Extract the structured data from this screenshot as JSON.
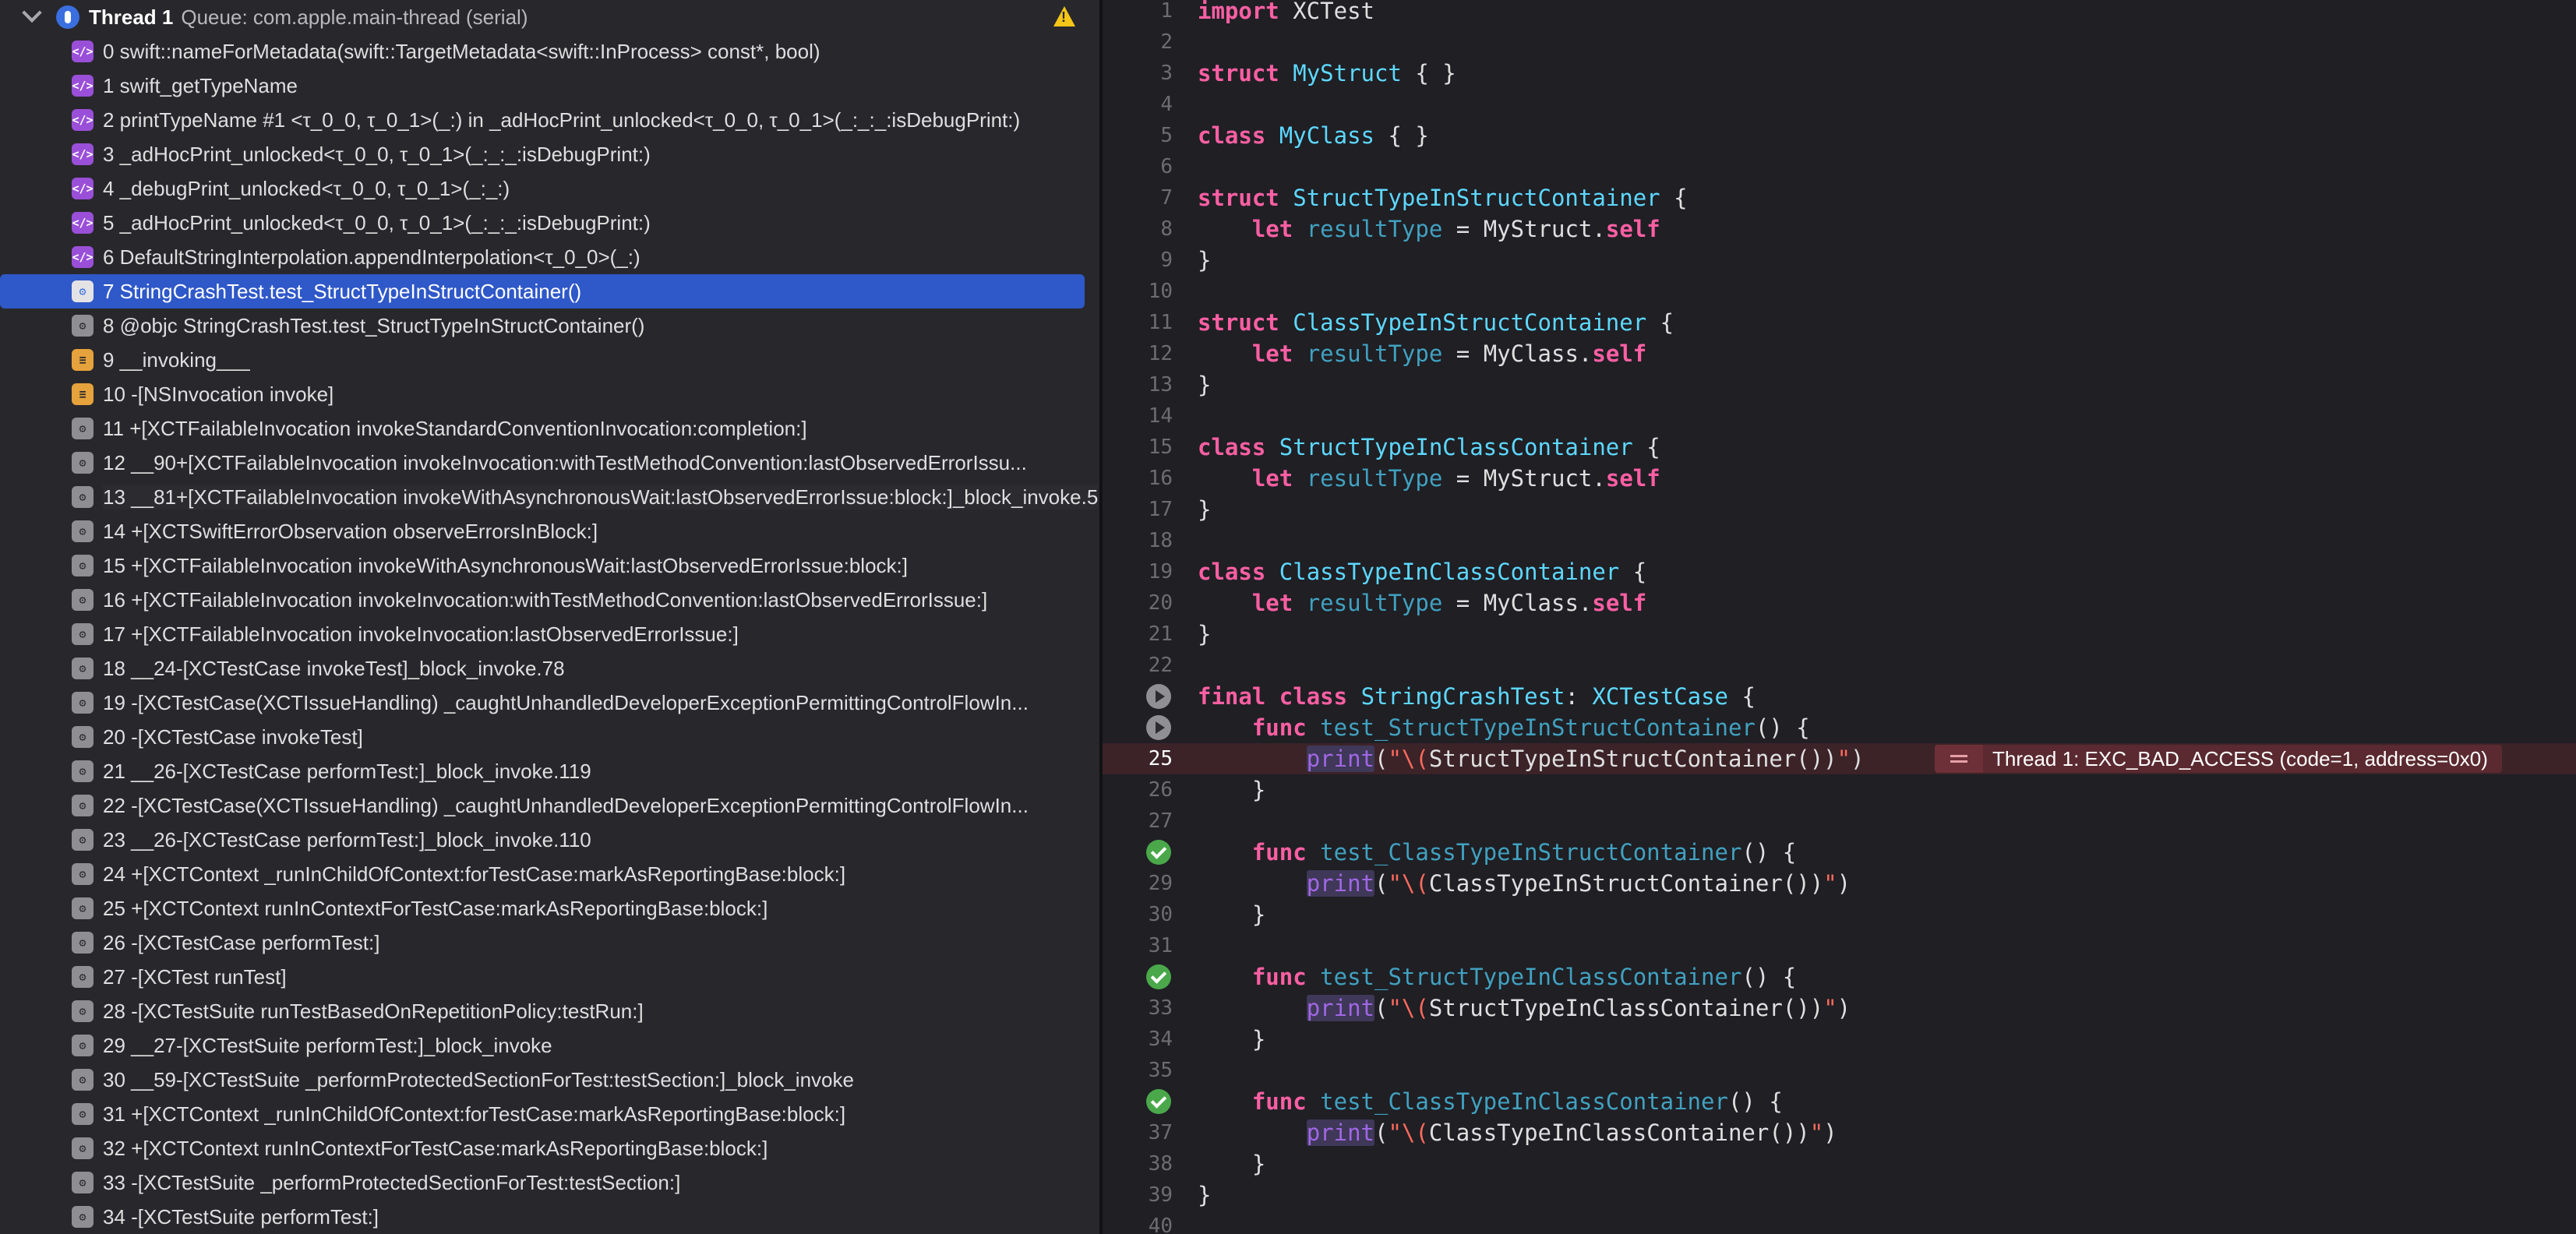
{
  "thread": {
    "title": "Thread 1",
    "queue": "Queue: com.apple.main-thread (serial)"
  },
  "frames": [
    {
      "label": "0 swift::nameForMetadata(swift::TargetMetadata<swift::InProcess> const*, bool)",
      "icon": "swift-icon"
    },
    {
      "label": "1 swift_getTypeName",
      "icon": "swift-icon"
    },
    {
      "label": "2 printTypeName #1 <τ_0_0, τ_0_1>(_:) in _adHocPrint_unlocked<τ_0_0, τ_0_1>(_:_:_:isDebugPrint:)",
      "icon": "swift-icon"
    },
    {
      "label": "3 _adHocPrint_unlocked<τ_0_0, τ_0_1>(_:_:_:isDebugPrint:)",
      "icon": "swift-icon"
    },
    {
      "label": "4 _debugPrint_unlocked<τ_0_0, τ_0_1>(_:_:)",
      "icon": "swift-icon"
    },
    {
      "label": "5 _adHocPrint_unlocked<τ_0_0, τ_0_1>(_:_:_:isDebugPrint:)",
      "icon": "swift-icon"
    },
    {
      "label": "6 DefaultStringInterpolation.appendInterpolation<τ_0_0>(_:)",
      "icon": "swift-icon"
    },
    {
      "label": "7 StringCrashTest.test_StructTypeInStructContainer()",
      "icon": "user-code-icon"
    },
    {
      "label": "8 @objc StringCrashTest.test_StructTypeInStructContainer()",
      "icon": "gear-icon"
    },
    {
      "label": "9 __invoking___",
      "icon": "objc-icon"
    },
    {
      "label": "10 -[NSInvocation invoke]",
      "icon": "objc-icon"
    },
    {
      "label": "11 +[XCTFailableInvocation invokeStandardConventionInvocation:completion:]",
      "icon": "gear-icon"
    },
    {
      "label": "12 __90+[XCTFailableInvocation invokeInvocation:withTestMethodConvention:lastObservedErrorIssu...",
      "icon": "gear-icon"
    },
    {
      "label": "13 __81+[XCTFailableInvocation invokeWithAsynchronousWait:lastObservedErrorIssue:block:]_block_invoke.5",
      "icon": "gear-icon"
    },
    {
      "label": "14 +[XCTSwiftErrorObservation observeErrorsInBlock:]",
      "icon": "gear-icon"
    },
    {
      "label": "15 +[XCTFailableInvocation invokeWithAsynchronousWait:lastObservedErrorIssue:block:]",
      "icon": "gear-icon"
    },
    {
      "label": "16 +[XCTFailableInvocation invokeInvocation:withTestMethodConvention:lastObservedErrorIssue:]",
      "icon": "gear-icon"
    },
    {
      "label": "17 +[XCTFailableInvocation invokeInvocation:lastObservedErrorIssue:]",
      "icon": "gear-icon"
    },
    {
      "label": "18 __24-[XCTestCase invokeTest]_block_invoke.78",
      "icon": "gear-icon"
    },
    {
      "label": "19 -[XCTestCase(XCTIssueHandling) _caughtUnhandledDeveloperExceptionPermittingControlFlowIn...",
      "icon": "gear-icon"
    },
    {
      "label": "20 -[XCTestCase invokeTest]",
      "icon": "gear-icon"
    },
    {
      "label": "21 __26-[XCTestCase performTest:]_block_invoke.119",
      "icon": "gear-icon"
    },
    {
      "label": "22 -[XCTestCase(XCTIssueHandling) _caughtUnhandledDeveloperExceptionPermittingControlFlowIn...",
      "icon": "gear-icon"
    },
    {
      "label": "23 __26-[XCTestCase performTest:]_block_invoke.110",
      "icon": "gear-icon"
    },
    {
      "label": "24 +[XCTContext _runInChildOfContext:forTestCase:markAsReportingBase:block:]",
      "icon": "gear-icon"
    },
    {
      "label": "25 +[XCTContext runInContextForTestCase:markAsReportingBase:block:]",
      "icon": "gear-icon"
    },
    {
      "label": "26 -[XCTestCase performTest:]",
      "icon": "gear-icon"
    },
    {
      "label": "27 -[XCTest runTest]",
      "icon": "gear-icon"
    },
    {
      "label": "28 -[XCTestSuite runTestBasedOnRepetitionPolicy:testRun:]",
      "icon": "gear-icon"
    },
    {
      "label": "29 __27-[XCTestSuite performTest:]_block_invoke",
      "icon": "gear-icon"
    },
    {
      "label": "30 __59-[XCTestSuite _performProtectedSectionForTest:testSection:]_block_invoke",
      "icon": "gear-icon"
    },
    {
      "label": "31 +[XCTContext _runInChildOfContext:forTestCase:markAsReportingBase:block:]",
      "icon": "gear-icon"
    },
    {
      "label": "32 +[XCTContext runInContextForTestCase:markAsReportingBase:block:]",
      "icon": "gear-icon"
    },
    {
      "label": "33 -[XCTestSuite _performProtectedSectionForTest:testSection:]",
      "icon": "gear-icon"
    },
    {
      "label": "34 -[XCTestSuite performTest:]",
      "icon": "gear-icon"
    }
  ],
  "selected_frame": 7,
  "editor": {
    "lines": [
      {
        "n": "1",
        "tokens": [
          [
            "kw",
            "import"
          ],
          [
            "plain",
            " XCTest"
          ]
        ]
      },
      {
        "n": "2",
        "tokens": []
      },
      {
        "n": "3",
        "tokens": [
          [
            "kw",
            "struct"
          ],
          [
            "plain",
            " "
          ],
          [
            "typ",
            "MyStruct"
          ],
          [
            "plain",
            " { }"
          ]
        ]
      },
      {
        "n": "4",
        "tokens": []
      },
      {
        "n": "5",
        "tokens": [
          [
            "kw",
            "class"
          ],
          [
            "plain",
            " "
          ],
          [
            "typ",
            "MyClass"
          ],
          [
            "plain",
            " { }"
          ]
        ]
      },
      {
        "n": "6",
        "tokens": []
      },
      {
        "n": "7",
        "tokens": [
          [
            "kw",
            "struct"
          ],
          [
            "plain",
            " "
          ],
          [
            "typ",
            "StructTypeInStructContainer"
          ],
          [
            "plain",
            " {"
          ]
        ]
      },
      {
        "n": "8",
        "tokens": [
          [
            "plain",
            "    "
          ],
          [
            "kw",
            "let"
          ],
          [
            "plain",
            " "
          ],
          [
            "decl",
            "resultType"
          ],
          [
            "plain",
            " = "
          ],
          [
            "plain",
            "MyStruct"
          ],
          [
            "plain",
            "."
          ],
          [
            "kw",
            "self"
          ]
        ]
      },
      {
        "n": "9",
        "tokens": [
          [
            "plain",
            "}"
          ]
        ]
      },
      {
        "n": "10",
        "tokens": []
      },
      {
        "n": "11",
        "tokens": [
          [
            "kw",
            "struct"
          ],
          [
            "plain",
            " "
          ],
          [
            "typ",
            "ClassTypeInStructContainer"
          ],
          [
            "plain",
            " {"
          ]
        ]
      },
      {
        "n": "12",
        "tokens": [
          [
            "plain",
            "    "
          ],
          [
            "kw",
            "let"
          ],
          [
            "plain",
            " "
          ],
          [
            "decl",
            "resultType"
          ],
          [
            "plain",
            " = "
          ],
          [
            "plain",
            "MyClass"
          ],
          [
            "plain",
            "."
          ],
          [
            "kw",
            "self"
          ]
        ]
      },
      {
        "n": "13",
        "tokens": [
          [
            "plain",
            "}"
          ]
        ]
      },
      {
        "n": "14",
        "tokens": []
      },
      {
        "n": "15",
        "tokens": [
          [
            "kw",
            "class"
          ],
          [
            "plain",
            " "
          ],
          [
            "typ",
            "StructTypeInClassContainer"
          ],
          [
            "plain",
            " {"
          ]
        ]
      },
      {
        "n": "16",
        "tokens": [
          [
            "plain",
            "    "
          ],
          [
            "kw",
            "let"
          ],
          [
            "plain",
            " "
          ],
          [
            "decl",
            "resultType"
          ],
          [
            "plain",
            " = "
          ],
          [
            "plain",
            "MyStruct"
          ],
          [
            "plain",
            "."
          ],
          [
            "kw",
            "self"
          ]
        ]
      },
      {
        "n": "17",
        "tokens": [
          [
            "plain",
            "}"
          ]
        ]
      },
      {
        "n": "18",
        "tokens": []
      },
      {
        "n": "19",
        "tokens": [
          [
            "kw",
            "class"
          ],
          [
            "plain",
            " "
          ],
          [
            "typ",
            "ClassTypeInClassContainer"
          ],
          [
            "plain",
            " {"
          ]
        ]
      },
      {
        "n": "20",
        "tokens": [
          [
            "plain",
            "    "
          ],
          [
            "kw",
            "let"
          ],
          [
            "plain",
            " "
          ],
          [
            "decl",
            "resultType"
          ],
          [
            "plain",
            " = "
          ],
          [
            "plain",
            "MyClass"
          ],
          [
            "plain",
            "."
          ],
          [
            "kw",
            "self"
          ]
        ]
      },
      {
        "n": "21",
        "tokens": [
          [
            "plain",
            "}"
          ]
        ]
      },
      {
        "n": "22",
        "tokens": []
      },
      {
        "n": "23",
        "marker": "run",
        "tokens": [
          [
            "kw",
            "final"
          ],
          [
            "plain",
            " "
          ],
          [
            "kw",
            "class"
          ],
          [
            "plain",
            " "
          ],
          [
            "typ",
            "StringCrashTest"
          ],
          [
            "plain",
            ": "
          ],
          [
            "typ",
            "XCTestCase"
          ],
          [
            "plain",
            " {"
          ]
        ]
      },
      {
        "n": "24",
        "marker": "run",
        "tokens": [
          [
            "plain",
            "    "
          ],
          [
            "kw",
            "func"
          ],
          [
            "plain",
            " "
          ],
          [
            "decl",
            "test_StructTypeInStructContainer"
          ],
          [
            "plain",
            "() {"
          ]
        ]
      },
      {
        "n": "25",
        "error": true,
        "tokens": [
          [
            "plain",
            "        "
          ],
          [
            "fn",
            "print"
          ],
          [
            "plain",
            "("
          ],
          [
            "str",
            "\"\\("
          ],
          [
            "plain",
            "StructTypeInStructContainer"
          ],
          [
            "plain",
            "())"
          ],
          [
            "str",
            "\""
          ],
          [
            "plain",
            ")"
          ]
        ]
      },
      {
        "n": "26",
        "tokens": [
          [
            "plain",
            "    }"
          ]
        ]
      },
      {
        "n": "27",
        "tokens": []
      },
      {
        "n": "28",
        "marker": "pass",
        "tokens": [
          [
            "plain",
            "    "
          ],
          [
            "kw",
            "func"
          ],
          [
            "plain",
            " "
          ],
          [
            "decl",
            "test_ClassTypeInStructContainer"
          ],
          [
            "plain",
            "() {"
          ]
        ]
      },
      {
        "n": "29",
        "tokens": [
          [
            "plain",
            "        "
          ],
          [
            "fn",
            "print"
          ],
          [
            "plain",
            "("
          ],
          [
            "str",
            "\"\\("
          ],
          [
            "plain",
            "ClassTypeInStructContainer"
          ],
          [
            "plain",
            "())"
          ],
          [
            "str",
            "\""
          ],
          [
            "plain",
            ")"
          ]
        ]
      },
      {
        "n": "30",
        "tokens": [
          [
            "plain",
            "    }"
          ]
        ]
      },
      {
        "n": "31",
        "tokens": []
      },
      {
        "n": "32",
        "marker": "pass",
        "tokens": [
          [
            "plain",
            "    "
          ],
          [
            "kw",
            "func"
          ],
          [
            "plain",
            " "
          ],
          [
            "decl",
            "test_StructTypeInClassContainer"
          ],
          [
            "plain",
            "() {"
          ]
        ]
      },
      {
        "n": "33",
        "tokens": [
          [
            "plain",
            "        "
          ],
          [
            "fn",
            "print"
          ],
          [
            "plain",
            "("
          ],
          [
            "str",
            "\"\\("
          ],
          [
            "plain",
            "StructTypeInClassContainer"
          ],
          [
            "plain",
            "())"
          ],
          [
            "str",
            "\""
          ],
          [
            "plain",
            ")"
          ]
        ]
      },
      {
        "n": "34",
        "tokens": [
          [
            "plain",
            "    }"
          ]
        ]
      },
      {
        "n": "35",
        "tokens": []
      },
      {
        "n": "36",
        "marker": "pass",
        "tokens": [
          [
            "plain",
            "    "
          ],
          [
            "kw",
            "func"
          ],
          [
            "plain",
            " "
          ],
          [
            "decl",
            "test_ClassTypeInClassContainer"
          ],
          [
            "plain",
            "() {"
          ]
        ]
      },
      {
        "n": "37",
        "tokens": [
          [
            "plain",
            "        "
          ],
          [
            "fn",
            "print"
          ],
          [
            "plain",
            "("
          ],
          [
            "str",
            "\"\\("
          ],
          [
            "plain",
            "ClassTypeInClassContainer"
          ],
          [
            "plain",
            "())"
          ],
          [
            "str",
            "\""
          ],
          [
            "plain",
            ")"
          ]
        ]
      },
      {
        "n": "38",
        "tokens": [
          [
            "plain",
            "    }"
          ]
        ]
      },
      {
        "n": "39",
        "tokens": [
          [
            "plain",
            "}"
          ]
        ]
      },
      {
        "n": "40",
        "tokens": []
      }
    ],
    "error_message": "Thread 1: EXC_BAD_ACCESS (code=1, address=0x0)"
  },
  "colors": {
    "selection": "#2f58c8",
    "keyword": "#fc5fa3",
    "type": "#5dd8ff",
    "declaration": "#41a1c0",
    "function": "#a167e6",
    "string": "#fc6a5d",
    "error_background": "#3b2328",
    "warning": "#f5c518",
    "test_pass": "#4aa84a"
  }
}
